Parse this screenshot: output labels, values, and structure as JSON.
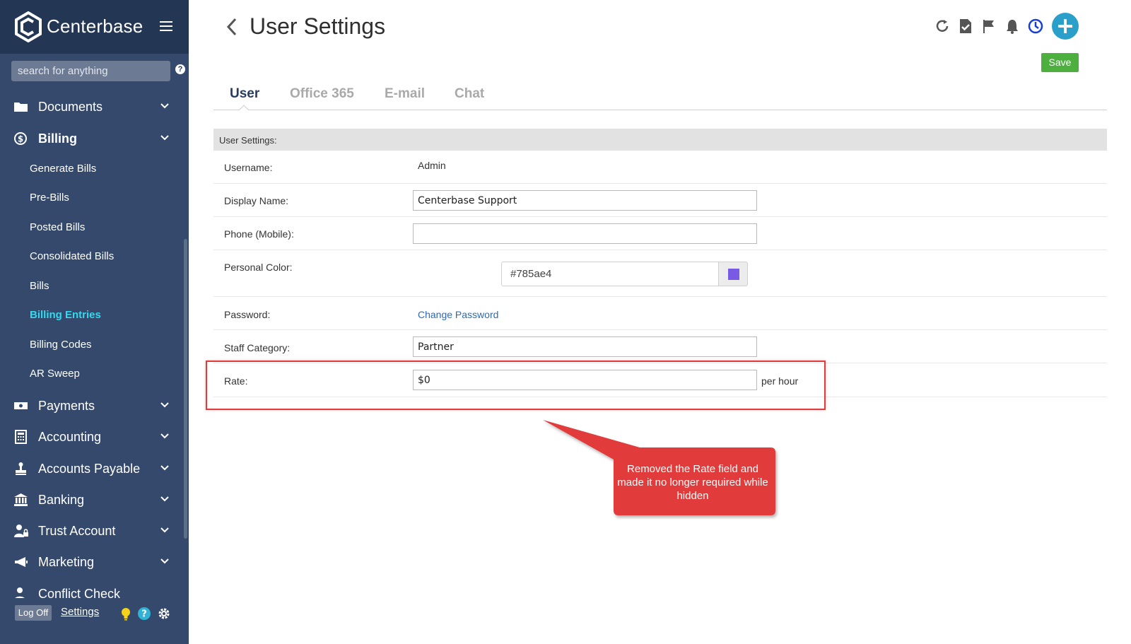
{
  "app": {
    "brand": "Centerbase",
    "search_placeholder": "search for anything",
    "search_help": "?"
  },
  "sidebar": {
    "nav": [
      {
        "label": "Documents",
        "icon": "folder-icon"
      },
      {
        "label": "Billing",
        "icon": "dollar-icon",
        "expanded": true
      },
      {
        "label": "Payments",
        "icon": "money-icon"
      },
      {
        "label": "Accounting",
        "icon": "calculator-icon"
      },
      {
        "label": "Accounts Payable",
        "icon": "stamp-icon"
      },
      {
        "label": "Banking",
        "icon": "bank-icon"
      },
      {
        "label": "Trust Account",
        "icon": "user-lock-icon"
      },
      {
        "label": "Marketing",
        "icon": "megaphone-icon"
      },
      {
        "label": "Conflict Check",
        "icon": "user-icon"
      }
    ],
    "billing_sub": [
      {
        "label": "Generate Bills"
      },
      {
        "label": "Pre-Bills"
      },
      {
        "label": "Posted Bills"
      },
      {
        "label": "Consolidated Bills"
      },
      {
        "label": "Bills"
      },
      {
        "label": "Billing Entries",
        "active": true
      },
      {
        "label": "Billing Codes"
      },
      {
        "label": "AR Sweep"
      }
    ],
    "footer": {
      "logoff": "Log Off",
      "settings": "Settings"
    }
  },
  "header": {
    "title": "User Settings",
    "save_label": "Save",
    "icons": [
      "refresh-icon",
      "task-check-icon",
      "flag-icon",
      "bell-icon",
      "clock-icon",
      "add-icon"
    ]
  },
  "tabs": [
    {
      "label": "User",
      "active": true
    },
    {
      "label": "Office 365"
    },
    {
      "label": "E-mail"
    },
    {
      "label": "Chat"
    }
  ],
  "form": {
    "section_title": "User Settings:",
    "username_label": "Username:",
    "username_value": "Admin",
    "display_name_label": "Display Name:",
    "display_name_value": "Centerbase Support",
    "phone_label": "Phone (Mobile):",
    "phone_value": "",
    "personal_color_label": "Personal Color:",
    "personal_color_value": "#785ae4",
    "password_label": "Password:",
    "change_password": "Change Password",
    "staff_category_label": "Staff Category:",
    "staff_category_value": "Partner",
    "rate_label": "Rate:",
    "rate_value": "$0",
    "rate_unit": "per hour"
  },
  "annotation": {
    "callout_text": "Removed the Rate field and made it no longer required while hidden"
  },
  "colors": {
    "sidebar_bg": "#34496b",
    "brand_bg": "#233653",
    "active_sub": "#33d9ee",
    "save_green": "#4caf3e",
    "add_blue": "#2a9fc9",
    "callout_red": "#e23b3b",
    "swatch": "#785ae4"
  }
}
